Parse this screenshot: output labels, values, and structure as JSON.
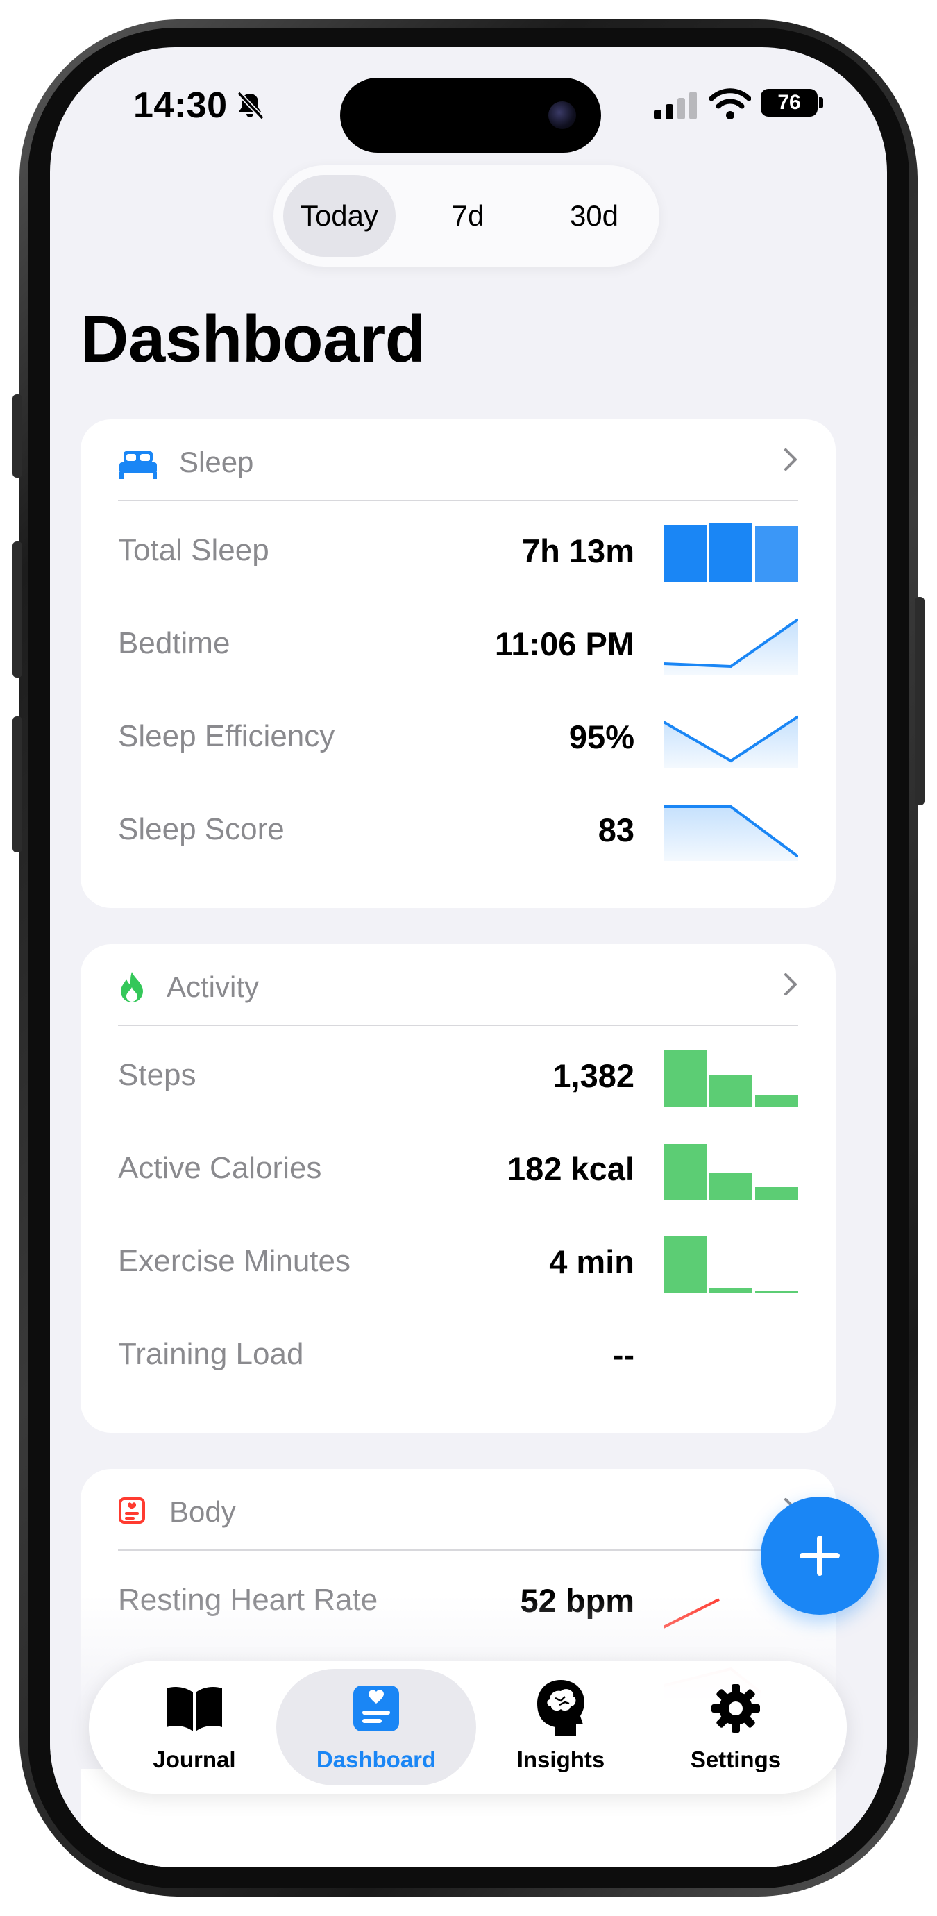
{
  "status_bar": {
    "time": "14:30",
    "battery": "76"
  },
  "range_tabs": [
    "Today",
    "7d",
    "30d"
  ],
  "page_title": "Dashboard",
  "colors": {
    "accent": "#1a86f5",
    "sleep": "#1a86f5",
    "activity": "#34c759",
    "body": "#ff3b30"
  },
  "sleep": {
    "title": "Sleep",
    "metrics": [
      {
        "label": "Total Sleep",
        "value": "7h 13m"
      },
      {
        "label": "Bedtime",
        "value": "11:06 PM"
      },
      {
        "label": "Sleep Efficiency",
        "value": "95%"
      },
      {
        "label": "Sleep Score",
        "value": "83"
      }
    ]
  },
  "activity": {
    "title": "Activity",
    "metrics": [
      {
        "label": "Steps",
        "value": "1,382"
      },
      {
        "label": "Active Calories",
        "value": "182 kcal"
      },
      {
        "label": "Exercise Minutes",
        "value": "4 min"
      },
      {
        "label": "Training Load",
        "value": "--"
      }
    ]
  },
  "body": {
    "title": "Body",
    "metrics": [
      {
        "label": "Resting Heart Rate",
        "value": "52 bpm"
      }
    ]
  },
  "tab_bar": {
    "items": [
      {
        "label": "Journal",
        "icon": "book-icon"
      },
      {
        "label": "Dashboard",
        "icon": "dashboard-icon"
      },
      {
        "label": "Insights",
        "icon": "brain-icon"
      },
      {
        "label": "Settings",
        "icon": "gear-icon"
      }
    ]
  }
}
